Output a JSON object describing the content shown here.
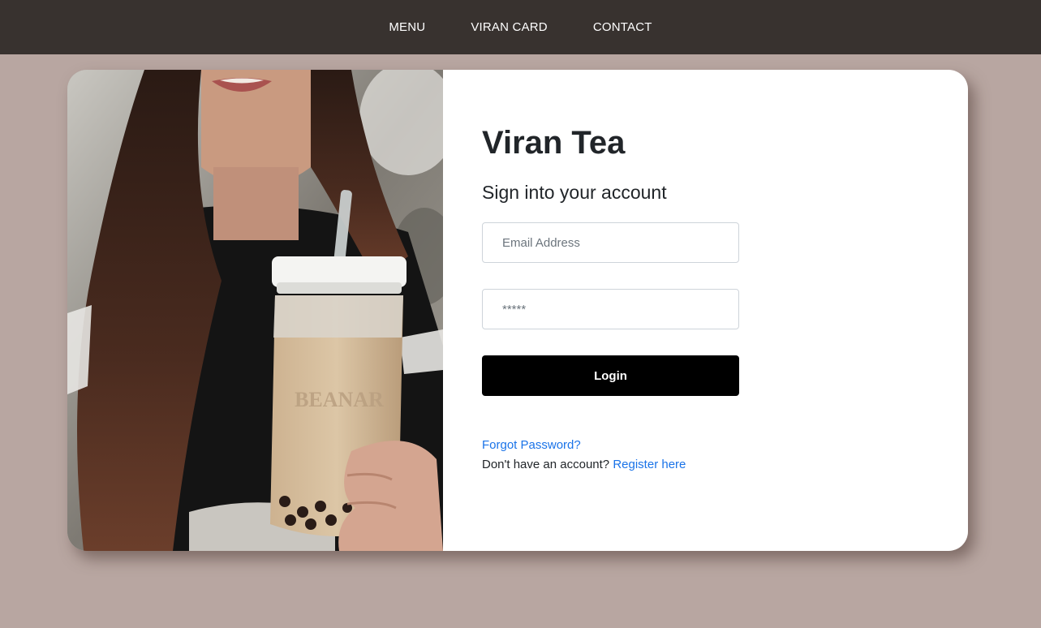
{
  "nav": {
    "items": [
      {
        "label": "MENU"
      },
      {
        "label": "VIRAN CARD"
      },
      {
        "label": "CONTACT"
      }
    ]
  },
  "login": {
    "brand": "Viran Tea",
    "subtitle": "Sign into your account",
    "email_placeholder": "Email Address",
    "password_placeholder": "*****",
    "login_label": "Login",
    "forgot_label": "Forgot Password?",
    "no_account_text": "Don't have an account?",
    "register_label": "Register here"
  },
  "photo": {
    "cup_text": "BEANAR"
  },
  "colors": {
    "page_bg": "#b8a6a1",
    "nav_bg": "#38322f",
    "button_bg": "#000000",
    "link": "#1a73e8"
  }
}
